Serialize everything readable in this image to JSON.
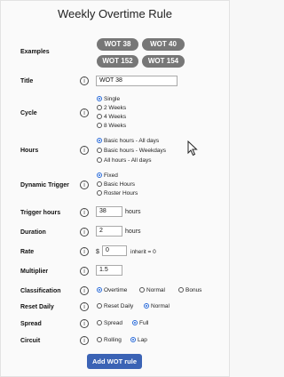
{
  "page": {
    "title": "Weekly Overtime Rule"
  },
  "examples": {
    "label": "Examples",
    "chips": [
      "WOT 38",
      "WOT 40",
      "WOT 152",
      "WOT 154"
    ]
  },
  "info_glyph": "i",
  "title_row": {
    "label": "Title",
    "value": "WOT 38"
  },
  "cycle": {
    "label": "Cycle",
    "options": [
      "Single",
      "2 Weeks",
      "4 Weeks",
      "8 Weeks"
    ],
    "selected": "Single"
  },
  "hours": {
    "label": "Hours",
    "options": [
      "Basic hours - All days",
      "Basic hours - Weekdays",
      "All hours - All days"
    ],
    "selected": "Basic hours - All days"
  },
  "dynamic_trigger": {
    "label": "Dynamic Trigger",
    "options": [
      "Fixed",
      "Basic Hours",
      "Roster Hours"
    ],
    "selected": "Fixed"
  },
  "trigger_hours": {
    "label": "Trigger hours",
    "value": "38",
    "unit": "hours"
  },
  "duration": {
    "label": "Duration",
    "value": "2",
    "unit": "hours"
  },
  "rate": {
    "label": "Rate",
    "currency": "$",
    "value": "0",
    "note": "inherit = 0"
  },
  "multiplier": {
    "label": "Multiplier",
    "value": "1.5"
  },
  "classification": {
    "label": "Classification",
    "options": [
      "Overtime",
      "Normal",
      "Bonus"
    ],
    "selected": "Overtime"
  },
  "reset_daily": {
    "label": "Reset Daily",
    "options": [
      "Reset Daily",
      "Normal"
    ],
    "selected": "Normal"
  },
  "spread": {
    "label": "Spread",
    "options": [
      "Spread",
      "Full"
    ],
    "selected": "Full"
  },
  "circuit": {
    "label": "Circuit",
    "options": [
      "Rolling",
      "Lap"
    ],
    "selected": "Lap"
  },
  "submit": {
    "label": "Add WOT rule"
  },
  "colors": {
    "accent": "#3b63b5",
    "chip": "#777777",
    "radio": "#2769d8"
  },
  "icons": {
    "info": "info-icon",
    "cursor": "mouse-pointer-icon"
  }
}
